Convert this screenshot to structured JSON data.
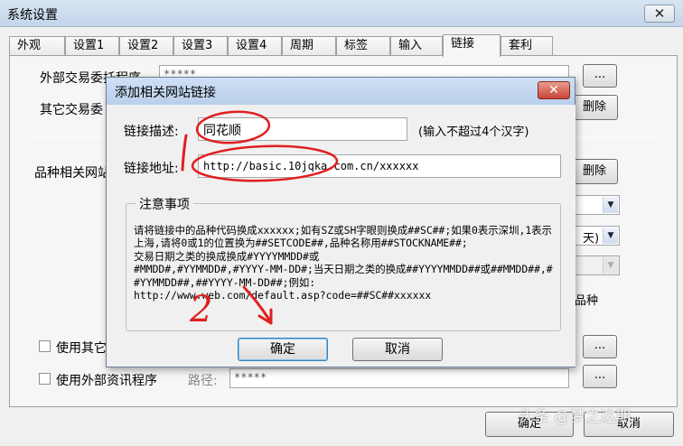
{
  "window": {
    "title": "系统设置",
    "close_glyph": "✕"
  },
  "tabs": [
    {
      "label": "外观"
    },
    {
      "label": "设置1"
    },
    {
      "label": "设置2"
    },
    {
      "label": "设置3"
    },
    {
      "label": "设置4"
    },
    {
      "label": "周期"
    },
    {
      "label": "标签"
    },
    {
      "label": "输入"
    },
    {
      "label": "链接",
      "active": true
    },
    {
      "label": "套利"
    }
  ],
  "background": {
    "external_trade_label": "外部交易委托程序",
    "external_trade_value": "*****",
    "browse_label": "...",
    "other_trade_label": "其它交易委",
    "delete_label": "删除",
    "variety_links_label": "品种相关网站",
    "delete2_label": "删除",
    "combo_suffix": "天)",
    "right_text": "品种",
    "use_other_label": "使用其它",
    "use_external_info_label": "使用外部资讯程序",
    "path_label": "路径:",
    "path_value": "*****",
    "ok_label": "确定",
    "cancel_label": "取消"
  },
  "dialog": {
    "title": "添加相关网站链接",
    "close_glyph": "✕",
    "desc_label": "链接描述:",
    "desc_value": "同花顺",
    "desc_hint": "(输入不超过4个汉字)",
    "url_label": "链接地址:",
    "url_value": "http://basic.10jqka.com.cn/xxxxxx",
    "notice_title": "注意事项",
    "notice_text": "请将链接中的品种代码换成xxxxxx;如有SZ或SH字眼则换成##SC##;如果0表示深圳,1表示上海,请将0或1的位置换为##SETCODE##,品种名称用##STOCKNAME##;\n交易日期之类的换成换成#YYYYMMDD#或\n#MMDD#,#YYMMDD#,#YYYY-MM-DD#;当天日期之类的换成##YYYYMMDD##或##MMDD##,##YYMMDD##,##YYYY-MM-DD##;例如:\nhttp://www.web.com/default.asp?code=##SC##xxxxxx",
    "ok_label": "确定",
    "cancel_label": "取消"
  },
  "annotations": {
    "color": "#e02020",
    "numeral": "2"
  },
  "watermark": {
    "text": "头条 @梦之达期"
  }
}
